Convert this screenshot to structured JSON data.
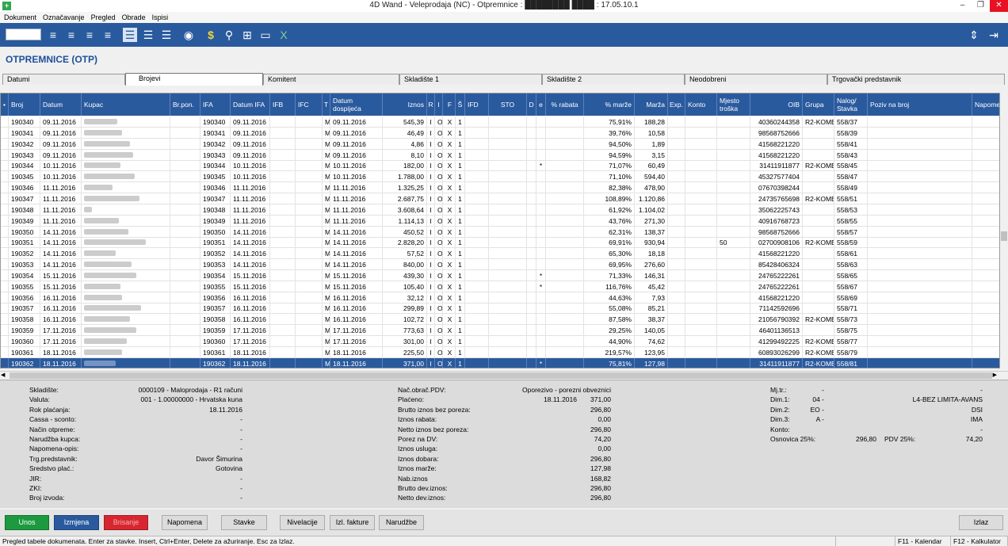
{
  "window": {
    "app_icon": "+",
    "title": "4D Wand - Veleprodaja (NC) - Otpremnice : ████████ ████ : 17.05.10.1"
  },
  "menu": [
    "Dokument",
    "Označavanje",
    "Pregled",
    "Obrade",
    "Ispisi"
  ],
  "toolbar_icons": [
    "list-add-icon",
    "list-add2-icon",
    "list-remove-icon",
    "list-refresh-icon",
    "view-list-selected-icon",
    "view-list-icon",
    "view-list2-icon",
    "circle-icon",
    "dollar-icon",
    "search-icon",
    "tree-icon",
    "monitor-icon",
    "excel-icon"
  ],
  "page_title": "OTPREMNICE (OTP)",
  "tabs": [
    "Datumi",
    "Brojevi",
    "Komitent",
    "Skladište 1",
    "Skladište 2",
    "Neodobreni",
    "Trgovački predstavnik"
  ],
  "columns": [
    {
      "key": "mark",
      "label": "•"
    },
    {
      "key": "broj",
      "label": "Broj"
    },
    {
      "key": "datum",
      "label": "Datum"
    },
    {
      "key": "kupac",
      "label": "Kupac"
    },
    {
      "key": "brpon",
      "label": "Br.pon."
    },
    {
      "key": "ifa",
      "label": "IFA"
    },
    {
      "key": "datumifa",
      "label": "Datum IFA"
    },
    {
      "key": "ifb",
      "label": "IFB"
    },
    {
      "key": "ifc",
      "label": "IFC"
    },
    {
      "key": "t",
      "label": "T"
    },
    {
      "key": "dosp",
      "label": "Datum dospijeća"
    },
    {
      "key": "iznos",
      "label": "Iznos"
    },
    {
      "key": "r",
      "label": "R"
    },
    {
      "key": "i",
      "label": "I"
    },
    {
      "key": "f",
      "label": "F"
    },
    {
      "key": "s",
      "label": "Š"
    },
    {
      "key": "ifd",
      "label": "IFD"
    },
    {
      "key": "sto",
      "label": "STO"
    },
    {
      "key": "d",
      "label": "D"
    },
    {
      "key": "e",
      "label": "e"
    },
    {
      "key": "rabat",
      "label": "% rabata"
    },
    {
      "key": "pmarze",
      "label": "% marže"
    },
    {
      "key": "marza",
      "label": "Marža"
    },
    {
      "key": "exp",
      "label": "Exp."
    },
    {
      "key": "konto",
      "label": "Konto"
    },
    {
      "key": "mjesto",
      "label": "Mjesto troška"
    },
    {
      "key": "oib",
      "label": "OIB"
    },
    {
      "key": "grupa",
      "label": "Grupa"
    },
    {
      "key": "nalog",
      "label": "Nalog/ Stavka"
    },
    {
      "key": "poziv",
      "label": "Poziv na broj"
    },
    {
      "key": "napomena",
      "label": "Napome"
    }
  ],
  "rows": [
    {
      "broj": "190340",
      "datum": "09.11.2016",
      "ifa": "190340",
      "datumifa": "09.11.2016",
      "t": "M",
      "dosp": "09.11.2016",
      "iznos": "545,39",
      "i": "I",
      "o": "O",
      "f": "X",
      "s": "1",
      "e": "",
      "pmarze": "75,91%",
      "marza": "188,28",
      "mjesto": "",
      "oib": "40360244358",
      "grupa": "R2-KOME",
      "nalog": "558/37"
    },
    {
      "broj": "190341",
      "datum": "09.11.2016",
      "ifa": "190341",
      "datumifa": "09.11.2016",
      "t": "M",
      "dosp": "09.11.2016",
      "iznos": "46,49",
      "i": "I",
      "o": "O",
      "f": "X",
      "s": "1",
      "e": "",
      "pmarze": "39,76%",
      "marza": "10,58",
      "mjesto": "",
      "oib": "98568752666",
      "grupa": "",
      "nalog": "558/39"
    },
    {
      "broj": "190342",
      "datum": "09.11.2016",
      "ifa": "190342",
      "datumifa": "09.11.2016",
      "t": "M",
      "dosp": "09.11.2016",
      "iznos": "4,86",
      "i": "I",
      "o": "O",
      "f": "X",
      "s": "1",
      "e": "",
      "pmarze": "94,50%",
      "marza": "1,89",
      "mjesto": "",
      "oib": "41568221220",
      "grupa": "",
      "nalog": "558/41"
    },
    {
      "broj": "190343",
      "datum": "09.11.2016",
      "ifa": "190343",
      "datumifa": "09.11.2016",
      "t": "M",
      "dosp": "09.11.2016",
      "iznos": "8,10",
      "i": "I",
      "o": "O",
      "f": "X",
      "s": "1",
      "e": "",
      "pmarze": "94,59%",
      "marza": "3,15",
      "mjesto": "",
      "oib": "41568221220",
      "grupa": "",
      "nalog": "558/43"
    },
    {
      "broj": "190344",
      "datum": "10.11.2016",
      "ifa": "190344",
      "datumifa": "10.11.2016",
      "t": "M",
      "dosp": "10.11.2016",
      "iznos": "182,00",
      "i": "I",
      "o": "O",
      "f": "X",
      "s": "1",
      "e": "*",
      "pmarze": "71,07%",
      "marza": "60,49",
      "mjesto": "",
      "oib": "31411911877",
      "grupa": "R2-KOME",
      "nalog": "558/45"
    },
    {
      "broj": "190345",
      "datum": "10.11.2016",
      "ifa": "190345",
      "datumifa": "10.11.2016",
      "t": "M",
      "dosp": "10.11.2016",
      "iznos": "1.788,00",
      "i": "I",
      "o": "O",
      "f": "X",
      "s": "1",
      "e": "",
      "pmarze": "71,10%",
      "marza": "594,40",
      "mjesto": "",
      "oib": "45327577404",
      "grupa": "",
      "nalog": "558/47"
    },
    {
      "broj": "190346",
      "datum": "11.11.2016",
      "ifa": "190346",
      "datumifa": "11.11.2016",
      "t": "M",
      "dosp": "11.11.2016",
      "iznos": "1.325,25",
      "i": "I",
      "o": "O",
      "f": "X",
      "s": "1",
      "e": "",
      "pmarze": "82,38%",
      "marza": "478,90",
      "mjesto": "",
      "oib": "07670398244",
      "grupa": "",
      "nalog": "558/49"
    },
    {
      "broj": "190347",
      "datum": "11.11.2016",
      "ifa": "190347",
      "datumifa": "11.11.2016",
      "t": "M",
      "dosp": "11.11.2016",
      "iznos": "2.687,75",
      "i": "I",
      "o": "O",
      "f": "X",
      "s": "1",
      "e": "",
      "pmarze": "108,89%",
      "marza": "1.120,86",
      "mjesto": "",
      "oib": "24735765698",
      "grupa": "R2-KOME",
      "nalog": "558/51"
    },
    {
      "broj": "190348",
      "datum": "11.11.2016",
      "ifa": "190348",
      "datumifa": "11.11.2016",
      "t": "M",
      "dosp": "11.11.2016",
      "iznos": "3.608,64",
      "i": "I",
      "o": "O",
      "f": "X",
      "s": "1",
      "e": "",
      "pmarze": "61,92%",
      "marza": "1.104,02",
      "mjesto": "",
      "oib": "35062225743",
      "grupa": "",
      "nalog": "558/53"
    },
    {
      "broj": "190349",
      "datum": "11.11.2016",
      "ifa": "190349",
      "datumifa": "11.11.2016",
      "t": "M",
      "dosp": "11.11.2016",
      "iznos": "1.114,13",
      "i": "I",
      "o": "O",
      "f": "X",
      "s": "1",
      "e": "",
      "pmarze": "43,76%",
      "marza": "271,30",
      "mjesto": "",
      "oib": "40916768723",
      "grupa": "",
      "nalog": "558/55"
    },
    {
      "broj": "190350",
      "datum": "14.11.2016",
      "ifa": "190350",
      "datumifa": "14.11.2016",
      "t": "M",
      "dosp": "14.11.2016",
      "iznos": "450,52",
      "i": "I",
      "o": "O",
      "f": "X",
      "s": "1",
      "e": "",
      "pmarze": "62,31%",
      "marza": "138,37",
      "mjesto": "",
      "oib": "98568752666",
      "grupa": "",
      "nalog": "558/57"
    },
    {
      "broj": "190351",
      "datum": "14.11.2016",
      "ifa": "190351",
      "datumifa": "14.11.2016",
      "t": "M",
      "dosp": "14.11.2016",
      "iznos": "2.828,20",
      "i": "I",
      "o": "O",
      "f": "X",
      "s": "1",
      "e": "",
      "pmarze": "69,91%",
      "marza": "930,94",
      "mjesto": "50",
      "oib": "02700908106",
      "grupa": "R2-KOME",
      "nalog": "558/59"
    },
    {
      "broj": "190352",
      "datum": "14.11.2016",
      "ifa": "190352",
      "datumifa": "14.11.2016",
      "t": "M",
      "dosp": "14.11.2016",
      "iznos": "57,52",
      "i": "I",
      "o": "O",
      "f": "X",
      "s": "1",
      "e": "",
      "pmarze": "65,30%",
      "marza": "18,18",
      "mjesto": "",
      "oib": "41568221220",
      "grupa": "",
      "nalog": "558/61"
    },
    {
      "broj": "190353",
      "datum": "14.11.2016",
      "ifa": "190353",
      "datumifa": "14.11.2016",
      "t": "M",
      "dosp": "14.11.2016",
      "iznos": "840,00",
      "i": "I",
      "o": "O",
      "f": "X",
      "s": "1",
      "e": "",
      "pmarze": "69,95%",
      "marza": "276,60",
      "mjesto": "",
      "oib": "85428406324",
      "grupa": "",
      "nalog": "558/63"
    },
    {
      "broj": "190354",
      "datum": "15.11.2016",
      "ifa": "190354",
      "datumifa": "15.11.2016",
      "t": "M",
      "dosp": "15.11.2016",
      "iznos": "439,30",
      "i": "I",
      "o": "O",
      "f": "X",
      "s": "1",
      "e": "*",
      "pmarze": "71,33%",
      "marza": "146,31",
      "mjesto": "",
      "oib": "24765222261",
      "grupa": "",
      "nalog": "558/65"
    },
    {
      "broj": "190355",
      "datum": "15.11.2016",
      "ifa": "190355",
      "datumifa": "15.11.2016",
      "t": "M",
      "dosp": "15.11.2016",
      "iznos": "105,40",
      "i": "I",
      "o": "O",
      "f": "X",
      "s": "1",
      "e": "*",
      "pmarze": "116,76%",
      "marza": "45,42",
      "mjesto": "",
      "oib": "24765222261",
      "grupa": "",
      "nalog": "558/67"
    },
    {
      "broj": "190356",
      "datum": "16.11.2016",
      "ifa": "190356",
      "datumifa": "16.11.2016",
      "t": "M",
      "dosp": "16.11.2016",
      "iznos": "32,12",
      "i": "I",
      "o": "O",
      "f": "X",
      "s": "1",
      "e": "",
      "pmarze": "44,63%",
      "marza": "7,93",
      "mjesto": "",
      "oib": "41568221220",
      "grupa": "",
      "nalog": "558/69"
    },
    {
      "broj": "190357",
      "datum": "16.11.2016",
      "ifa": "190357",
      "datumifa": "16.11.2016",
      "t": "M",
      "dosp": "16.11.2016",
      "iznos": "299,89",
      "i": "I",
      "o": "O",
      "f": "X",
      "s": "1",
      "e": "",
      "pmarze": "55,08%",
      "marza": "85,21",
      "mjesto": "",
      "oib": "71142592696",
      "grupa": "",
      "nalog": "558/71"
    },
    {
      "broj": "190358",
      "datum": "16.11.2016",
      "ifa": "190358",
      "datumifa": "16.11.2016",
      "t": "M",
      "dosp": "16.11.2016",
      "iznos": "102,72",
      "i": "I",
      "o": "O",
      "f": "X",
      "s": "1",
      "e": "",
      "pmarze": "87,58%",
      "marza": "38,37",
      "mjesto": "",
      "oib": "21056790392",
      "grupa": "R2-KOME",
      "nalog": "558/73"
    },
    {
      "broj": "190359",
      "datum": "17.11.2016",
      "ifa": "190359",
      "datumifa": "17.11.2016",
      "t": "M",
      "dosp": "17.11.2016",
      "iznos": "773,63",
      "i": "I",
      "o": "O",
      "f": "X",
      "s": "1",
      "e": "",
      "pmarze": "29,25%",
      "marza": "140,05",
      "mjesto": "",
      "oib": "46401136513",
      "grupa": "",
      "nalog": "558/75"
    },
    {
      "broj": "190360",
      "datum": "17.11.2016",
      "ifa": "190360",
      "datumifa": "17.11.2016",
      "t": "M",
      "dosp": "17.11.2016",
      "iznos": "301,00",
      "i": "I",
      "o": "O",
      "f": "X",
      "s": "1",
      "e": "",
      "pmarze": "44,90%",
      "marza": "74,62",
      "mjesto": "",
      "oib": "41299492225",
      "grupa": "R2-KOME",
      "nalog": "558/77"
    },
    {
      "broj": "190361",
      "datum": "18.11.2016",
      "ifa": "190361",
      "datumifa": "18.11.2016",
      "t": "M",
      "dosp": "18.11.2016",
      "iznos": "225,50",
      "i": "I",
      "o": "O",
      "f": "X",
      "s": "1",
      "e": "",
      "pmarze": "219,57%",
      "marza": "123,95",
      "mjesto": "",
      "oib": "60893026299",
      "grupa": "R2-KOME",
      "nalog": "558/79"
    },
    {
      "broj": "190362",
      "datum": "18.11.2016",
      "ifa": "190362",
      "datumifa": "18.11.2016",
      "t": "M",
      "dosp": "18.11.2016",
      "iznos": "371,00",
      "i": "I",
      "o": "O",
      "f": "X",
      "s": "1",
      "e": "*",
      "pmarze": "75,81%",
      "marza": "127,98",
      "mjesto": "",
      "oib": "31411911877",
      "grupa": "R2-KOME",
      "nalog": "558/81"
    }
  ],
  "details": {
    "left": [
      {
        "label": "Skladište:",
        "value": "0000109 - Maloprodaja - R1 računi"
      },
      {
        "label": "Valuta:",
        "value": "001 -    1.00000000 - Hrvatska kuna"
      },
      {
        "label": "Rok plaćanja:",
        "value": "18.11.2016"
      },
      {
        "label": "Cassa - sconto:",
        "value": "-"
      },
      {
        "label": "Način otpreme:",
        "value": "-"
      },
      {
        "label": "Narudžba kupca:",
        "value": "-"
      },
      {
        "label": "Napomena-opis:",
        "value": "-"
      },
      {
        "label": "Trg.predstavnik:",
        "value": "Davor Šimurina"
      },
      {
        "label": "Sredstvo plać.:",
        "value": "Gotovina"
      },
      {
        "label": "JIR:",
        "value": "-"
      },
      {
        "label": "ZKI:",
        "value": "-"
      },
      {
        "label": "Broj izvoda:",
        "value": "-"
      }
    ],
    "middle": [
      {
        "label": "Nač.obrač.PDV:",
        "value": "Oporezivo - porezni obveznici",
        "extra": ""
      },
      {
        "label": "Plaćeno:",
        "value": "371,00",
        "extra": "18.11.2016"
      },
      {
        "label": "Brutto iznos bez poreza:",
        "value": "296,80",
        "extra": ""
      },
      {
        "label": "Iznos rabata:",
        "value": "0,00",
        "extra": ""
      },
      {
        "label": "Netto iznos bez poreza:",
        "value": "296,80",
        "extra": ""
      },
      {
        "label": "Porez na DV:",
        "value": "74,20",
        "extra": ""
      },
      {
        "label": "Iznos usluga:",
        "value": "0,00",
        "extra": ""
      },
      {
        "label": "Iznos dobara:",
        "value": "296,80",
        "extra": ""
      },
      {
        "label": "Iznos marže:",
        "value": "127,98",
        "extra": ""
      },
      {
        "label": "Nab.iznos",
        "value": "168,82",
        "extra": ""
      },
      {
        "label": "Brutto dev.iznos:",
        "value": "296,80",
        "extra": ""
      },
      {
        "label": "Netto dev.iznos:",
        "value": "296,80",
        "extra": ""
      }
    ],
    "right": [
      {
        "label": "Mj.tr.:",
        "value": "-",
        "value2": "-"
      },
      {
        "label": "Dim.1:",
        "value": "04 -",
        "value2": "L4-BEZ LIMITA-AVANS"
      },
      {
        "label": "Dim.2:",
        "value": "EO -",
        "value2": "DSI"
      },
      {
        "label": "Dim.3:",
        "value": "A -",
        "value2": "IMA"
      },
      {
        "label": "Konto:",
        "value": "",
        "value2": "-"
      }
    ],
    "osnovica_label": "Osnovica 25%:",
    "osnovica_value": "296,80",
    "pdv_label": "PDV 25%:",
    "pdv_value": "74,20"
  },
  "buttons": [
    "Unos",
    "Izmjena",
    "Brisanje",
    "Napomena",
    "Stavke",
    "Nivelacije",
    "Izl. fakture",
    "Narudžbe",
    "Izlaz"
  ],
  "status": {
    "hint": "Pregled tabele dokumenata. Enter za stavke. Insert, Ctrl+Enter, Delete za ažuriranje. Esc za Izlaz.",
    "f11": "F11 - Kalendar",
    "f12": "F12 - Kalkulator"
  },
  "colors": {
    "header": "#2a5a9e",
    "selected_row": "#2a5a9e",
    "title": "#1e4f9c",
    "unos": "#1d9a3f",
    "brisanje": "#d7262f"
  }
}
